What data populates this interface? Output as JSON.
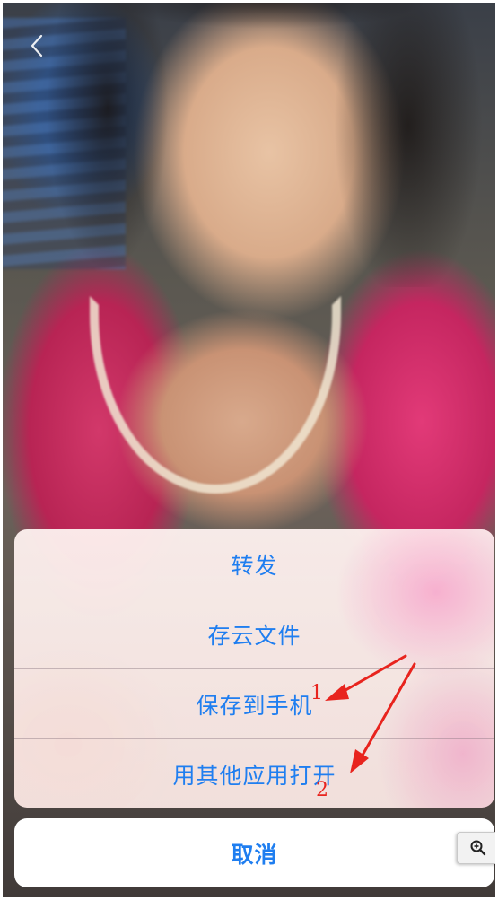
{
  "icons": {
    "back": "chevron-left-icon",
    "zoom": "zoom-in-icon"
  },
  "action_sheet": {
    "items": [
      {
        "label": "转发"
      },
      {
        "label": "存云文件"
      },
      {
        "label": "保存到手机"
      },
      {
        "label": "用其他应用打开"
      }
    ],
    "cancel_label": "取消"
  },
  "annotations": {
    "labels": [
      "1",
      "2"
    ],
    "color": "#e8241e"
  },
  "colors": {
    "action_text": "#1f7ef0",
    "cancel_background": "#ffffff"
  }
}
